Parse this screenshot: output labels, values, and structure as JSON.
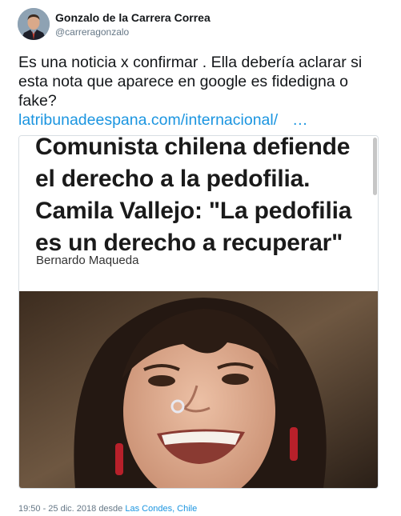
{
  "author": {
    "name": "Gonzalo de la Carrera Correa",
    "handle": "@carreragonzalo"
  },
  "tweet": {
    "text": "Es una noticia x confirmar . Ella debería aclarar si esta nota que aparece en google es fidedigna o fake?",
    "link": "latribunadeespana.com/internacional/",
    "link_ellipsis": "…"
  },
  "card": {
    "headline": "Comunista chilena defiende el derecho a la pedofilia. Camila Vallejo: \"La pedofilia es un derecho a recuperar\"",
    "byline": "Bernardo Maqueda"
  },
  "meta": {
    "time": "19:50 - 25 dic. 2018",
    "from": "desde",
    "location": "Las Condes, Chile"
  },
  "colors": {
    "link": "#1b95e0",
    "secondary_text": "#657786",
    "text": "#14171a"
  }
}
